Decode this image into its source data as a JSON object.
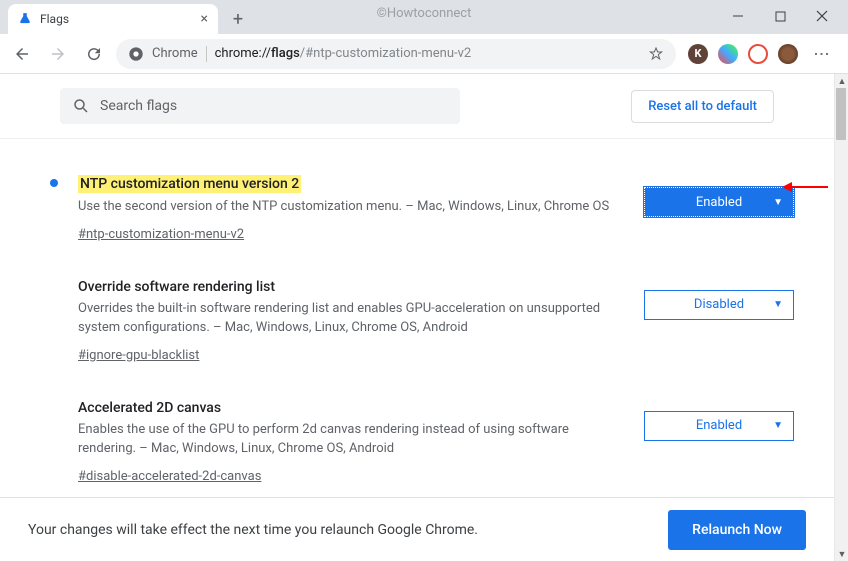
{
  "watermark": "©Howtoconnect",
  "tab": {
    "title": "Flags"
  },
  "omnibox": {
    "scheme_label": "Chrome",
    "url_host": "chrome://",
    "url_bold": "flags",
    "url_path": "/#ntp-customization-menu-v2"
  },
  "search": {
    "placeholder": "Search flags"
  },
  "reset_label": "Reset all to default",
  "flags": [
    {
      "title": "NTP customization menu version 2",
      "highlight": true,
      "bullet": true,
      "desc": "Use the second version of the NTP customization menu. – Mac, Windows, Linux, Chrome OS",
      "anchor": "#ntp-customization-menu-v2",
      "select_value": "Enabled",
      "select_filled": true
    },
    {
      "title": "Override software rendering list",
      "highlight": false,
      "bullet": false,
      "desc": "Overrides the built-in software rendering list and enables GPU-acceleration on unsupported system configurations. – Mac, Windows, Linux, Chrome OS, Android",
      "anchor": "#ignore-gpu-blacklist",
      "select_value": "Disabled",
      "select_filled": false
    },
    {
      "title": "Accelerated 2D canvas",
      "highlight": false,
      "bullet": false,
      "desc": "Enables the use of the GPU to perform 2d canvas rendering instead of using software rendering. – Mac, Windows, Linux, Chrome OS, Android",
      "anchor": "#disable-accelerated-2d-canvas",
      "select_value": "Enabled",
      "select_filled": false
    }
  ],
  "bottom": {
    "text": "Your changes will take effect the next time you relaunch Google Chrome.",
    "button": "Relaunch Now"
  }
}
